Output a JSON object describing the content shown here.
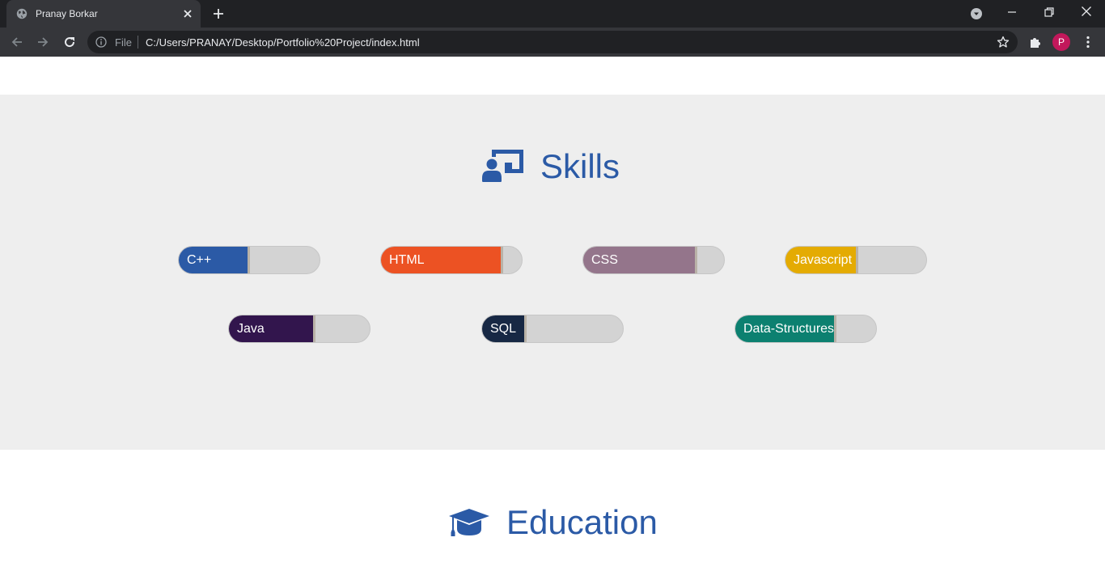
{
  "browser": {
    "tab_title": "Pranay Borkar",
    "scheme_label": "File",
    "url": "C:/Users/PRANAY/Desktop/Portfolio%20Project/index.html",
    "profile_initial": "P",
    "profile_color": "#c2185b"
  },
  "page": {
    "section_bg": "#eeeeee",
    "heading_color": "#2b5aa6",
    "skills_heading": "Skills",
    "education_heading": "Education",
    "skills_icon": "chalkboard-teacher-icon",
    "education_icon": "graduation-cap-icon"
  },
  "skills": [
    {
      "name": "C++",
      "level_percent": 50,
      "color": "#2b5aa6"
    },
    {
      "name": "HTML",
      "level_percent": 86,
      "color": "#ec5223"
    },
    {
      "name": "CSS",
      "level_percent": 80,
      "color": "#94758b"
    },
    {
      "name": "Javascript",
      "level_percent": 51,
      "color": "#e4ab02"
    },
    {
      "name": "Java",
      "level_percent": 61,
      "color": "#32154d"
    },
    {
      "name": "SQL",
      "level_percent": 31,
      "color": "#172844"
    },
    {
      "name": "Data-Structures",
      "level_percent": 71,
      "color": "#0c8070"
    }
  ]
}
